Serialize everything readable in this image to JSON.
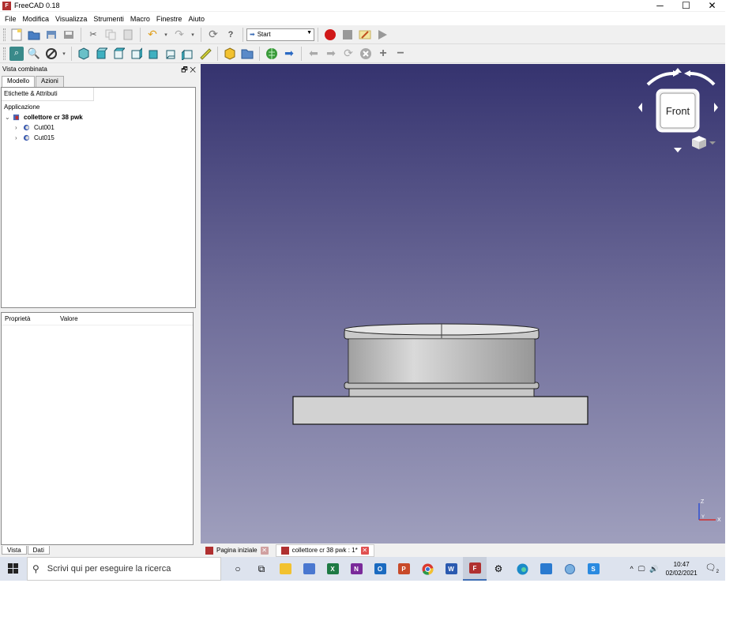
{
  "window": {
    "title": "FreeCAD 0.18",
    "min": "─",
    "max": "☐",
    "close": "✕"
  },
  "menu": [
    "File",
    "Modifica",
    "Visualizza",
    "Strumenti",
    "Macro",
    "Finestre",
    "Aiuto"
  ],
  "toolbar": {
    "workbench": "Start"
  },
  "panel": {
    "title": "Vista combinata",
    "tabs": [
      "Modello",
      "Azioni"
    ],
    "tree_header": "Etichette & Attributi",
    "tree_root_label": "Applicazione",
    "document": "collettore cr 38 pwk",
    "items": [
      "Cut001",
      "Cut015"
    ],
    "props_cols": [
      "Proprietà",
      "Valore"
    ],
    "bottom_tabs": [
      "Vista",
      "Dati"
    ]
  },
  "navcube": {
    "face": "Front"
  },
  "axes": {
    "z": "Z",
    "y": "Y",
    "x": "X"
  },
  "doc_tabs": [
    "Pagina iniziale",
    "collettore cr 38 pwk : 1*"
  ],
  "taskbar": {
    "search_placeholder": "Scrivi qui per eseguire la ricerca",
    "time": "10:47",
    "date": "02/02/2021",
    "notifications": "2"
  },
  "colors": {
    "view_top": "#35336f",
    "view_bottom": "#9f9fbd",
    "record": "#d01818"
  }
}
